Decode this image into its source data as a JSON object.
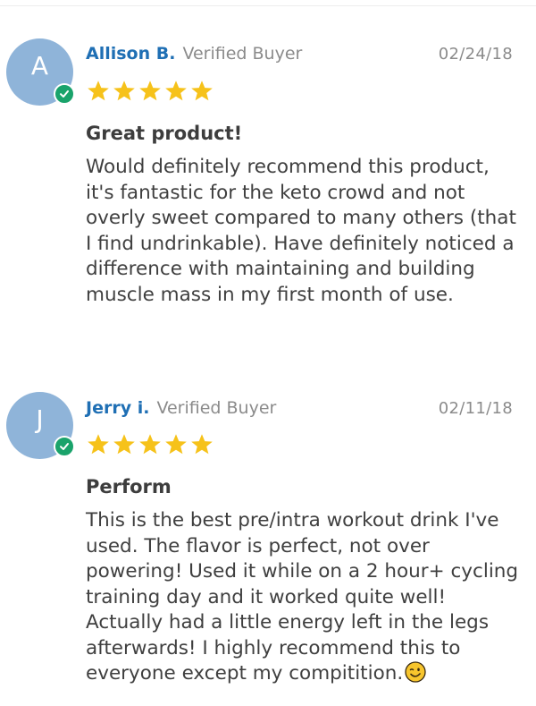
{
  "reviews": [
    {
      "avatar_initial": "A",
      "author": "Allison B.",
      "verified_label": "Verified Buyer",
      "date": "02/24/18",
      "rating": 5,
      "title": "Great product!",
      "body": "Would definitely recommend this product, it's fantastic for the keto crowd and not overly sweet compared to many others (that I find undrinkable). Have definitely noticed a difference with maintaining and building muscle mass in my first month of use."
    },
    {
      "avatar_initial": "J",
      "author": "Jerry i.",
      "verified_label": "Verified Buyer",
      "date": "02/11/18",
      "rating": 5,
      "title": "Perform",
      "body": "This is the best pre/intra workout drink I've used. The flavor is perfect, not over powering! Used it while on a 2 hour+ cycling training day and it worked quite well! Actually had a little energy left in the legs afterwards! I highly recommend this to everyone except my compitition."
    }
  ],
  "colors": {
    "avatar": "#8fb4d9",
    "verified_check": "#1aa36b",
    "author": "#1f6fb4",
    "star": "#f6c21a"
  },
  "icons": {
    "verified": "check-circle-icon",
    "star": "star-icon",
    "emoji": "winking-face-emoji"
  }
}
